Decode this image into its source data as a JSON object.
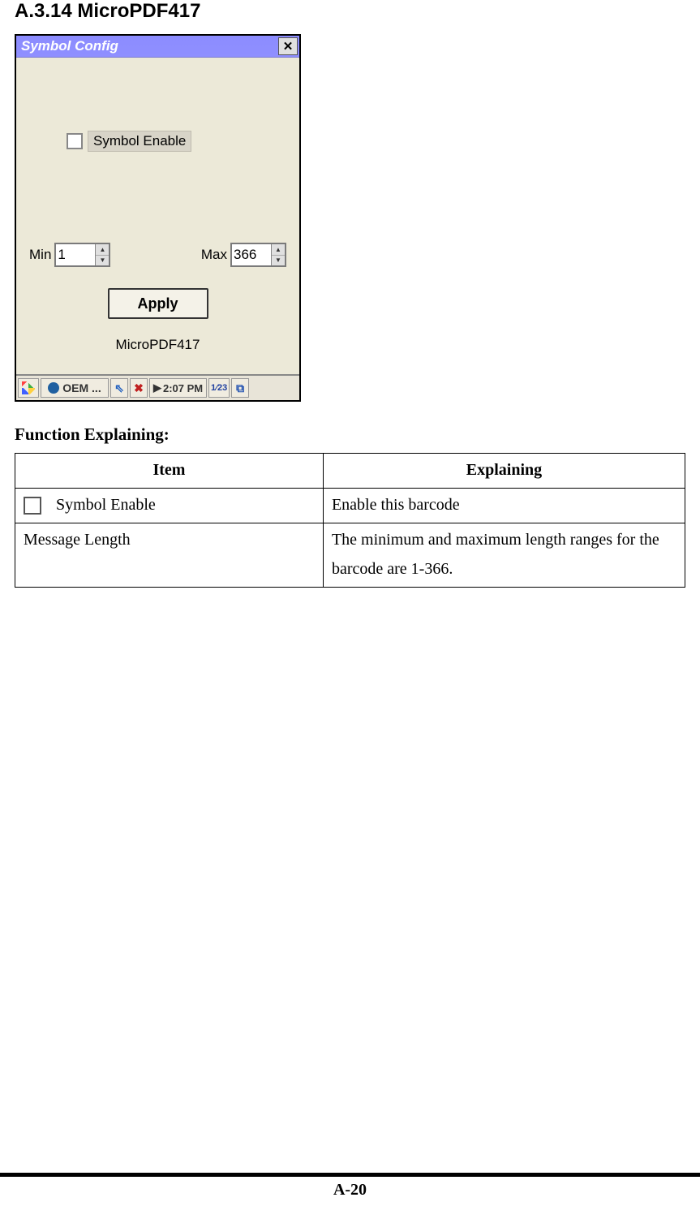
{
  "section_title": "A.3.14 MicroPDF417",
  "window": {
    "title": "Symbol Config",
    "close_glyph": "✕",
    "checkbox_label": "Symbol Enable",
    "min_label": "Min",
    "max_label": "Max",
    "min_value": "1",
    "max_value": "366",
    "apply_label": "Apply",
    "footer_label": "MicroPDF417"
  },
  "taskbar": {
    "oem_label": "OEM ...",
    "time": "2:07 PM",
    "tray1": "⇖",
    "tray2": "✖",
    "keyb": "1⁄23",
    "stack": "⧉"
  },
  "func_heading": "Function Explaining:",
  "table": {
    "headers": {
      "item": "Item",
      "explaining": "Explaining"
    },
    "rows": [
      {
        "item": "Symbol Enable",
        "explaining": "Enable this barcode",
        "has_checkbox": true
      },
      {
        "item": "Message Length",
        "explaining": "The minimum and maximum length ranges for the barcode are 1-366.",
        "has_checkbox": false
      }
    ]
  },
  "page_number": "A-20"
}
